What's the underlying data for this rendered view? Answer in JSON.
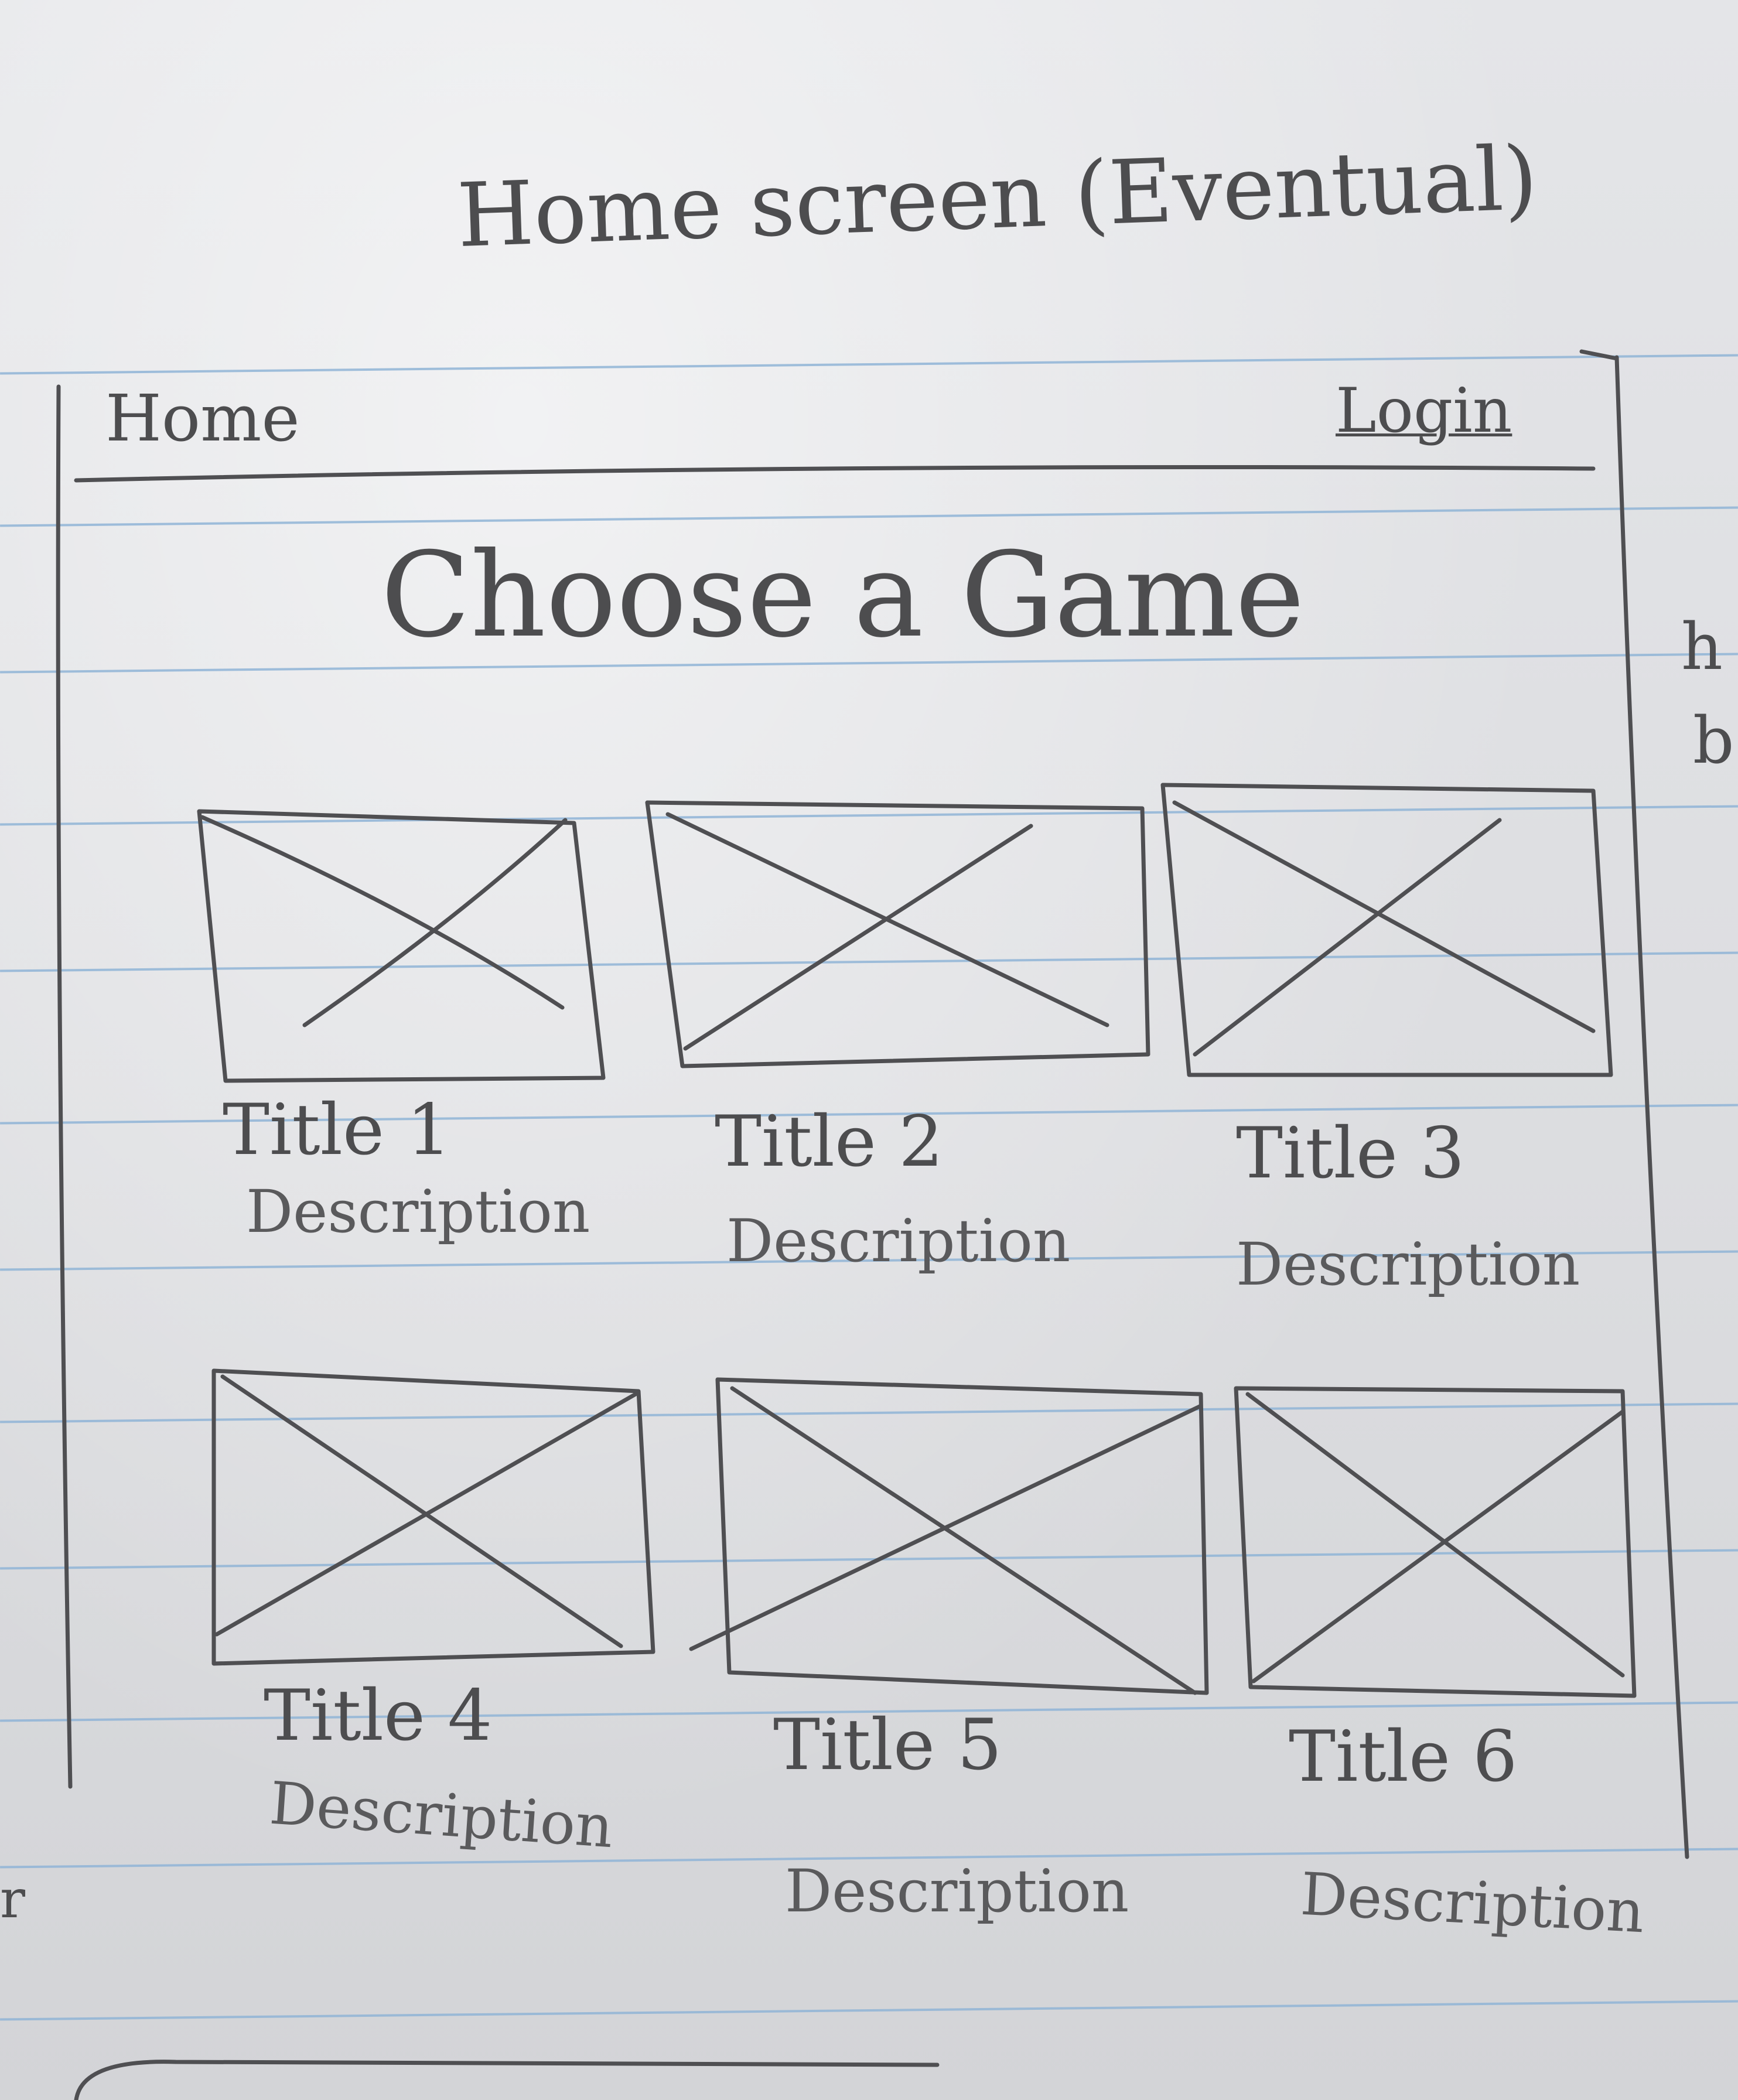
{
  "sheet_title": "Home screen (Eventual)",
  "nav": {
    "home_label": "Home",
    "login_label": "Login"
  },
  "page_heading": "Choose a Game",
  "cards": [
    {
      "title": "Title 1",
      "description": "Description"
    },
    {
      "title": "Title 2",
      "description": "Description"
    },
    {
      "title": "Title 3",
      "description": "Description"
    },
    {
      "title": "Title 4",
      "description": "Description"
    },
    {
      "title": "Title 5",
      "description": "Description"
    },
    {
      "title": "Title 6",
      "description": "Description"
    }
  ],
  "margin_notes": [
    "h",
    "b",
    "r"
  ],
  "colors": {
    "paper": "#dfe0e2",
    "rule_line": "#8fb4d6",
    "pencil": "#4d4d4f"
  },
  "image_placeholder_icon": "crossed-box-icon"
}
